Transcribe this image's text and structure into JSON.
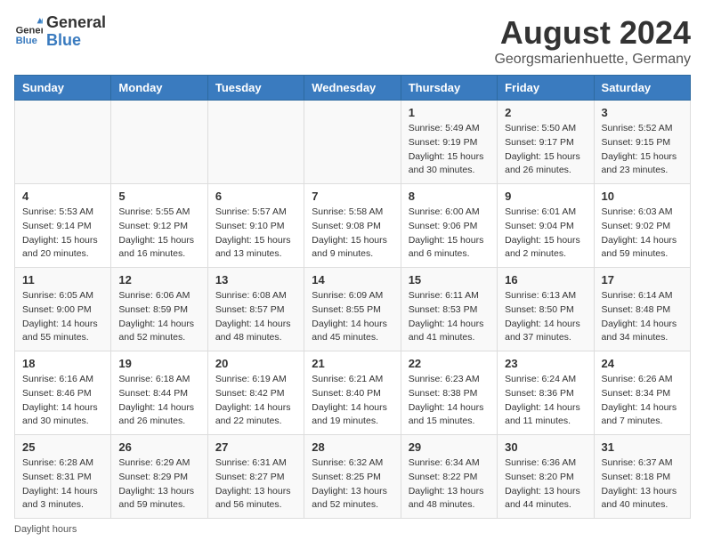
{
  "header": {
    "logo_general": "General",
    "logo_blue": "Blue",
    "month_title": "August 2024",
    "location": "Georgsmarienhuette, Germany"
  },
  "days_of_week": [
    "Sunday",
    "Monday",
    "Tuesday",
    "Wednesday",
    "Thursday",
    "Friday",
    "Saturday"
  ],
  "weeks": [
    [
      {
        "day": "",
        "info": ""
      },
      {
        "day": "",
        "info": ""
      },
      {
        "day": "",
        "info": ""
      },
      {
        "day": "",
        "info": ""
      },
      {
        "day": "1",
        "sunrise": "5:49 AM",
        "sunset": "9:19 PM",
        "daylight": "15 hours and 30 minutes."
      },
      {
        "day": "2",
        "sunrise": "5:50 AM",
        "sunset": "9:17 PM",
        "daylight": "15 hours and 26 minutes."
      },
      {
        "day": "3",
        "sunrise": "5:52 AM",
        "sunset": "9:15 PM",
        "daylight": "15 hours and 23 minutes."
      }
    ],
    [
      {
        "day": "4",
        "sunrise": "5:53 AM",
        "sunset": "9:14 PM",
        "daylight": "15 hours and 20 minutes."
      },
      {
        "day": "5",
        "sunrise": "5:55 AM",
        "sunset": "9:12 PM",
        "daylight": "15 hours and 16 minutes."
      },
      {
        "day": "6",
        "sunrise": "5:57 AM",
        "sunset": "9:10 PM",
        "daylight": "15 hours and 13 minutes."
      },
      {
        "day": "7",
        "sunrise": "5:58 AM",
        "sunset": "9:08 PM",
        "daylight": "15 hours and 9 minutes."
      },
      {
        "day": "8",
        "sunrise": "6:00 AM",
        "sunset": "9:06 PM",
        "daylight": "15 hours and 6 minutes."
      },
      {
        "day": "9",
        "sunrise": "6:01 AM",
        "sunset": "9:04 PM",
        "daylight": "15 hours and 2 minutes."
      },
      {
        "day": "10",
        "sunrise": "6:03 AM",
        "sunset": "9:02 PM",
        "daylight": "14 hours and 59 minutes."
      }
    ],
    [
      {
        "day": "11",
        "sunrise": "6:05 AM",
        "sunset": "9:00 PM",
        "daylight": "14 hours and 55 minutes."
      },
      {
        "day": "12",
        "sunrise": "6:06 AM",
        "sunset": "8:59 PM",
        "daylight": "14 hours and 52 minutes."
      },
      {
        "day": "13",
        "sunrise": "6:08 AM",
        "sunset": "8:57 PM",
        "daylight": "14 hours and 48 minutes."
      },
      {
        "day": "14",
        "sunrise": "6:09 AM",
        "sunset": "8:55 PM",
        "daylight": "14 hours and 45 minutes."
      },
      {
        "day": "15",
        "sunrise": "6:11 AM",
        "sunset": "8:53 PM",
        "daylight": "14 hours and 41 minutes."
      },
      {
        "day": "16",
        "sunrise": "6:13 AM",
        "sunset": "8:50 PM",
        "daylight": "14 hours and 37 minutes."
      },
      {
        "day": "17",
        "sunrise": "6:14 AM",
        "sunset": "8:48 PM",
        "daylight": "14 hours and 34 minutes."
      }
    ],
    [
      {
        "day": "18",
        "sunrise": "6:16 AM",
        "sunset": "8:46 PM",
        "daylight": "14 hours and 30 minutes."
      },
      {
        "day": "19",
        "sunrise": "6:18 AM",
        "sunset": "8:44 PM",
        "daylight": "14 hours and 26 minutes."
      },
      {
        "day": "20",
        "sunrise": "6:19 AM",
        "sunset": "8:42 PM",
        "daylight": "14 hours and 22 minutes."
      },
      {
        "day": "21",
        "sunrise": "6:21 AM",
        "sunset": "8:40 PM",
        "daylight": "14 hours and 19 minutes."
      },
      {
        "day": "22",
        "sunrise": "6:23 AM",
        "sunset": "8:38 PM",
        "daylight": "14 hours and 15 minutes."
      },
      {
        "day": "23",
        "sunrise": "6:24 AM",
        "sunset": "8:36 PM",
        "daylight": "14 hours and 11 minutes."
      },
      {
        "day": "24",
        "sunrise": "6:26 AM",
        "sunset": "8:34 PM",
        "daylight": "14 hours and 7 minutes."
      }
    ],
    [
      {
        "day": "25",
        "sunrise": "6:28 AM",
        "sunset": "8:31 PM",
        "daylight": "14 hours and 3 minutes."
      },
      {
        "day": "26",
        "sunrise": "6:29 AM",
        "sunset": "8:29 PM",
        "daylight": "13 hours and 59 minutes."
      },
      {
        "day": "27",
        "sunrise": "6:31 AM",
        "sunset": "8:27 PM",
        "daylight": "13 hours and 56 minutes."
      },
      {
        "day": "28",
        "sunrise": "6:32 AM",
        "sunset": "8:25 PM",
        "daylight": "13 hours and 52 minutes."
      },
      {
        "day": "29",
        "sunrise": "6:34 AM",
        "sunset": "8:22 PM",
        "daylight": "13 hours and 48 minutes."
      },
      {
        "day": "30",
        "sunrise": "6:36 AM",
        "sunset": "8:20 PM",
        "daylight": "13 hours and 44 minutes."
      },
      {
        "day": "31",
        "sunrise": "6:37 AM",
        "sunset": "8:18 PM",
        "daylight": "13 hours and 40 minutes."
      }
    ]
  ],
  "footer": {
    "note": "Daylight hours"
  }
}
